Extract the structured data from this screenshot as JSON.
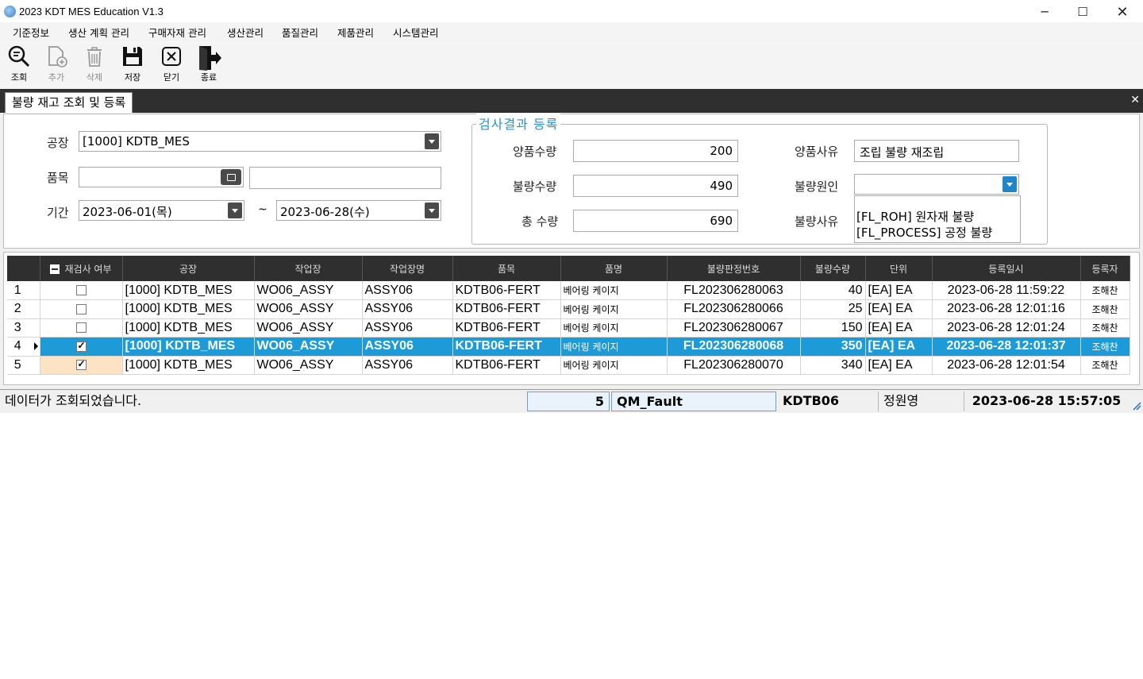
{
  "window": {
    "title": "2023 KDT MES Education V1.3",
    "min_glyph": "─",
    "max_glyph": "☐",
    "close_glyph": "✕"
  },
  "menu": [
    "기준정보",
    "생산 계획 관리",
    "구매자재 관리",
    "생산관리",
    "품질관리",
    "제품관리",
    "시스템관리"
  ],
  "toolbar": {
    "search": "조회",
    "add": "추가",
    "delete": "삭제",
    "save": "저장",
    "close": "닫기",
    "exit": "종료"
  },
  "tab": {
    "title": "불량 재고 조회 및 등록",
    "close_glyph": "✕"
  },
  "form": {
    "plant_label": "공장",
    "plant_value": "[1000] KDTB_MES",
    "item_label": "품목",
    "item_code": "",
    "item_name": "",
    "period_label": "기간",
    "date_from": "2023-06-01(목)",
    "date_to": "2023-06-28(수)",
    "tilde": "~"
  },
  "inspection": {
    "group_title": "검사결과 등록",
    "good_qty_label": "양품수량",
    "good_qty": "200",
    "bad_qty_label": "불량수량",
    "bad_qty": "490",
    "total_qty_label": "총 수량",
    "total_qty": "690",
    "good_reason_label": "양품사유",
    "good_reason": "조립 불량 재조립",
    "bad_cause_label": "불량원인",
    "bad_cause": "",
    "bad_reason_label": "불량사유",
    "bad_reasons": [
      "[FL_ROH] 원자재 불량",
      "[FL_PROCESS] 공정 불량"
    ]
  },
  "grid": {
    "headers": [
      "재검사 여부",
      "공장",
      "작업장",
      "작업장명",
      "품목",
      "품명",
      "불량판정번호",
      "불량수량",
      "단위",
      "등록일시",
      "등록자"
    ],
    "rows": [
      {
        "no": "1",
        "recheck": false,
        "plant": "[1000] KDTB_MES",
        "wc": "WO06_ASSY",
        "wc_name": "ASSY06",
        "item": "KDTB06-FERT",
        "item_name": "베어링 케이지",
        "fault_no": "FL202306280063",
        "qty": "40",
        "unit": "[EA] EA",
        "reg_dt": "2023-06-28 11:59:22",
        "reg_user": "조해찬"
      },
      {
        "no": "2",
        "recheck": false,
        "plant": "[1000] KDTB_MES",
        "wc": "WO06_ASSY",
        "wc_name": "ASSY06",
        "item": "KDTB06-FERT",
        "item_name": "베어링 케이지",
        "fault_no": "FL202306280066",
        "qty": "25",
        "unit": "[EA] EA",
        "reg_dt": "2023-06-28 12:01:16",
        "reg_user": "조해찬"
      },
      {
        "no": "3",
        "recheck": false,
        "plant": "[1000] KDTB_MES",
        "wc": "WO06_ASSY",
        "wc_name": "ASSY06",
        "item": "KDTB06-FERT",
        "item_name": "베어링 케이지",
        "fault_no": "FL202306280067",
        "qty": "150",
        "unit": "[EA] EA",
        "reg_dt": "2023-06-28 12:01:24",
        "reg_user": "조해찬"
      },
      {
        "no": "4",
        "recheck": true,
        "plant": "[1000] KDTB_MES",
        "wc": "WO06_ASSY",
        "wc_name": "ASSY06",
        "item": "KDTB06-FERT",
        "item_name": "베어링 케이지",
        "fault_no": "FL202306280068",
        "qty": "350",
        "unit": "[EA] EA",
        "reg_dt": "2023-06-28 12:01:37",
        "reg_user": "조해찬",
        "selected": true
      },
      {
        "no": "5",
        "recheck": true,
        "plant": "[1000] KDTB_MES",
        "wc": "WO06_ASSY",
        "wc_name": "ASSY06",
        "item": "KDTB06-FERT",
        "item_name": "베어링 케이지",
        "fault_no": "FL202306280070",
        "qty": "340",
        "unit": "[EA] EA",
        "reg_dt": "2023-06-28 12:01:54",
        "reg_user": "조해찬"
      }
    ]
  },
  "status": {
    "message": "데이터가 조회되었습니다.",
    "row_count": "5",
    "form_name": "QM_Fault",
    "plant_code": "KDTB06",
    "user_name": "정원영",
    "datetime": "2023-06-28 15:57:05"
  },
  "colors": {
    "accent": "#1e9ad6",
    "header_dark": "#2f2f2f",
    "group_title": "#2a8fd0",
    "peach": "#fde3c4"
  }
}
